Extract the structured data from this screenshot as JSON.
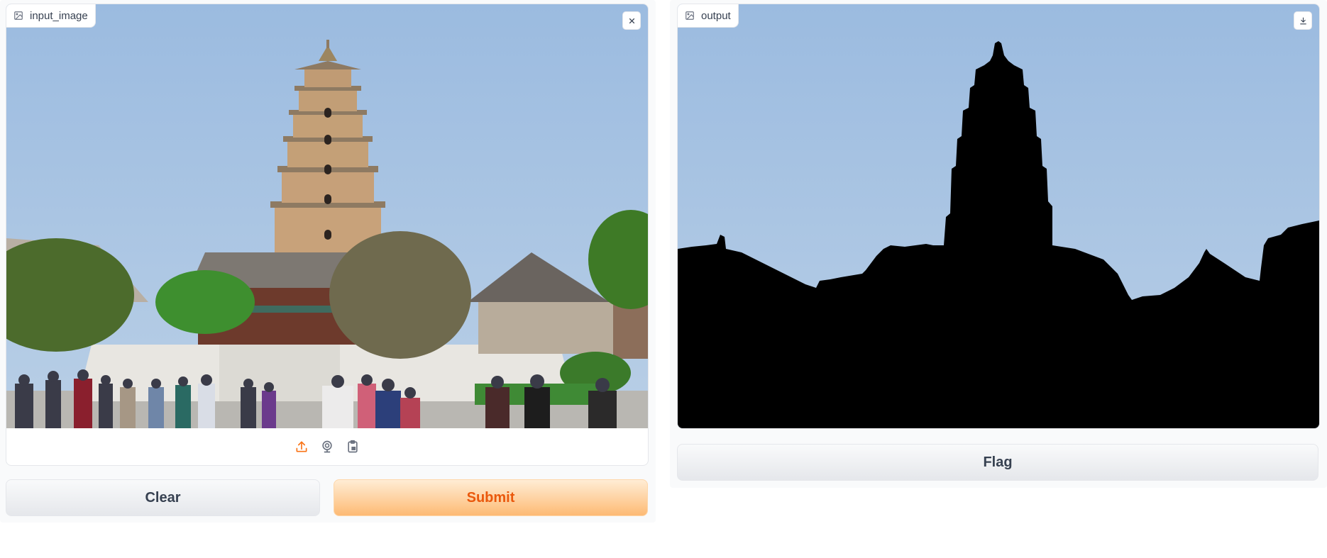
{
  "input_panel": {
    "label": "input_image",
    "label_icon": "image-icon",
    "clear_icon": "close-icon",
    "sources": [
      "upload-icon",
      "webcam-icon",
      "clipboard-icon"
    ]
  },
  "output_panel": {
    "label": "output",
    "label_icon": "image-icon",
    "download_icon": "download-icon"
  },
  "buttons": {
    "clear": "Clear",
    "submit": "Submit",
    "flag": "Flag"
  },
  "colors": {
    "primary_text": "#ea580c",
    "sky": "#a4c1e3",
    "mask": "#000000"
  }
}
